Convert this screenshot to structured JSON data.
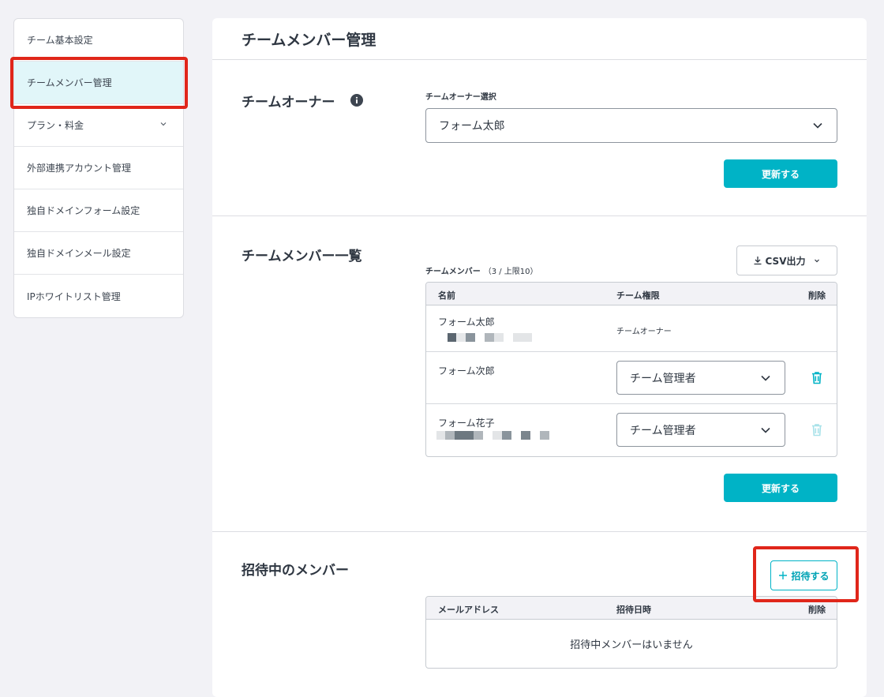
{
  "sidebar": {
    "items": [
      {
        "label": "チーム基本設定"
      },
      {
        "label": "チームメンバー管理"
      },
      {
        "label": "プラン・料金"
      },
      {
        "label": "外部連携アカウント管理"
      },
      {
        "label": "独自ドメインフォーム設定"
      },
      {
        "label": "独自ドメインメール設定"
      },
      {
        "label": "IPホワイトリスト管理"
      }
    ]
  },
  "main": {
    "page_title": "チームメンバー管理",
    "owner_section": {
      "title": "チームオーナー",
      "select_label": "チームオーナー選択",
      "selected_owner": "フォーム太郎",
      "update_button": "更新する"
    },
    "members_section": {
      "title": "チームメンバー一覧",
      "csv_button": "CSV出力",
      "table_label": "チームメンバー",
      "table_count": "（3 / 上限10）",
      "columns": {
        "name": "名前",
        "role": "チーム権限",
        "delete": "削除"
      },
      "rows": [
        {
          "name": "フォーム太郎",
          "role": "チームオーナー"
        },
        {
          "name": "フォーム次郎",
          "role": "チーム管理者"
        },
        {
          "name": "フォーム花子",
          "role": "チーム管理者"
        }
      ],
      "update_button": "更新する"
    },
    "invite_section": {
      "title": "招待中のメンバー",
      "invite_button": "招待する",
      "columns": {
        "email": "メールアドレス",
        "date": "招待日時",
        "delete": "削除"
      },
      "empty_message": "招待中メンバーはいません"
    }
  },
  "colors": {
    "accent": "#00b3c6",
    "highlight": "#e0261a",
    "active_bg": "#e1f6f9"
  }
}
